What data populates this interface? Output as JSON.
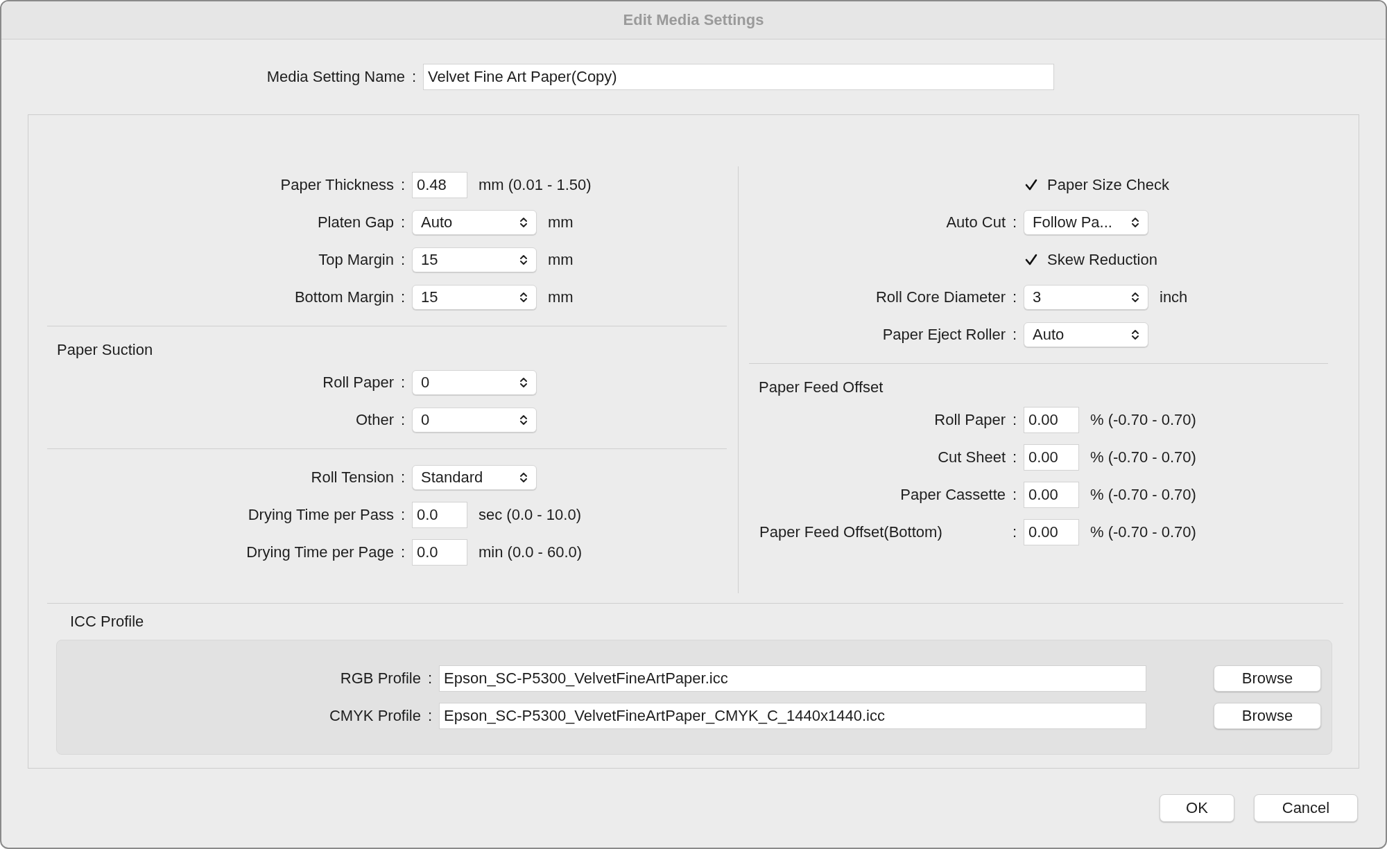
{
  "window": {
    "title": "Edit Media Settings"
  },
  "media_setting_name": {
    "label": "Media Setting Name",
    "sep": ":",
    "value": "Velvet Fine Art Paper(Copy)"
  },
  "left": {
    "general": [
      {
        "kind": "number",
        "label": "Paper Thickness",
        "sep": ":",
        "value": "0.48",
        "unit": "mm (0.01 - 1.50)"
      },
      {
        "kind": "select",
        "label": "Platen Gap",
        "sep": ":",
        "value": "Auto",
        "unit": "mm"
      },
      {
        "kind": "select",
        "label": "Top Margin",
        "sep": ":",
        "value": "15",
        "unit": "mm"
      },
      {
        "kind": "select",
        "label": "Bottom Margin",
        "sep": ":",
        "value": "15",
        "unit": "mm"
      }
    ],
    "paper_suction": {
      "title": "Paper Suction",
      "rows": [
        {
          "kind": "select",
          "label": "Roll Paper",
          "sep": ":",
          "value": "0"
        },
        {
          "kind": "select",
          "label": "Other",
          "sep": ":",
          "value": "0"
        }
      ]
    },
    "roll": [
      {
        "kind": "select",
        "label": "Roll Tension",
        "sep": ":",
        "value": "Standard"
      },
      {
        "kind": "number",
        "label": "Drying Time per Pass",
        "sep": ":",
        "value": "0.0",
        "unit": "sec (0.0 - 10.0)"
      },
      {
        "kind": "number",
        "label": "Drying Time per Page",
        "sep": ":",
        "value": "0.0",
        "unit": "min (0.0 - 60.0)"
      }
    ]
  },
  "right": {
    "general": [
      {
        "kind": "checkbox",
        "label": "Paper Size Check",
        "checked": true
      },
      {
        "kind": "select",
        "label": "Auto Cut",
        "sep": ":",
        "value": "Follow Pa..."
      },
      {
        "kind": "checkbox",
        "label": "Skew Reduction",
        "checked": true
      },
      {
        "kind": "select",
        "label": "Roll Core Diameter",
        "sep": ":",
        "value": "3",
        "unit": "inch"
      },
      {
        "kind": "select",
        "label": "Paper Eject Roller",
        "sep": ":",
        "value": "Auto"
      }
    ],
    "paper_feed_offset": {
      "title": "Paper Feed Offset",
      "rows": [
        {
          "kind": "number",
          "label": "Roll Paper",
          "sep": ":",
          "value": "0.00",
          "unit": "% (-0.70 - 0.70)"
        },
        {
          "kind": "number",
          "label": "Cut Sheet",
          "sep": ":",
          "value": "0.00",
          "unit": "% (-0.70 - 0.70)"
        },
        {
          "kind": "number",
          "label": "Paper Cassette",
          "sep": ":",
          "value": "0.00",
          "unit": "% (-0.70 - 0.70)"
        },
        {
          "kind": "number",
          "label": "Paper Feed Offset(Bottom)",
          "sep": ":",
          "value": "0.00",
          "unit": "% (-0.70 - 0.70)"
        }
      ]
    }
  },
  "icc_profile": {
    "title": "ICC Profile",
    "rows": [
      {
        "label": "RGB Profile",
        "sep": ":",
        "value": "Epson_SC-P5300_VelvetFineArtPaper.icc",
        "button": "Browse"
      },
      {
        "label": "CMYK Profile",
        "sep": ":",
        "value": "Epson_SC-P5300_VelvetFineArtPaper_CMYK_C_1440x1440.icc",
        "button": "Browse"
      }
    ]
  },
  "buttons": [
    {
      "label": "OK"
    },
    {
      "label": "Cancel"
    }
  ]
}
